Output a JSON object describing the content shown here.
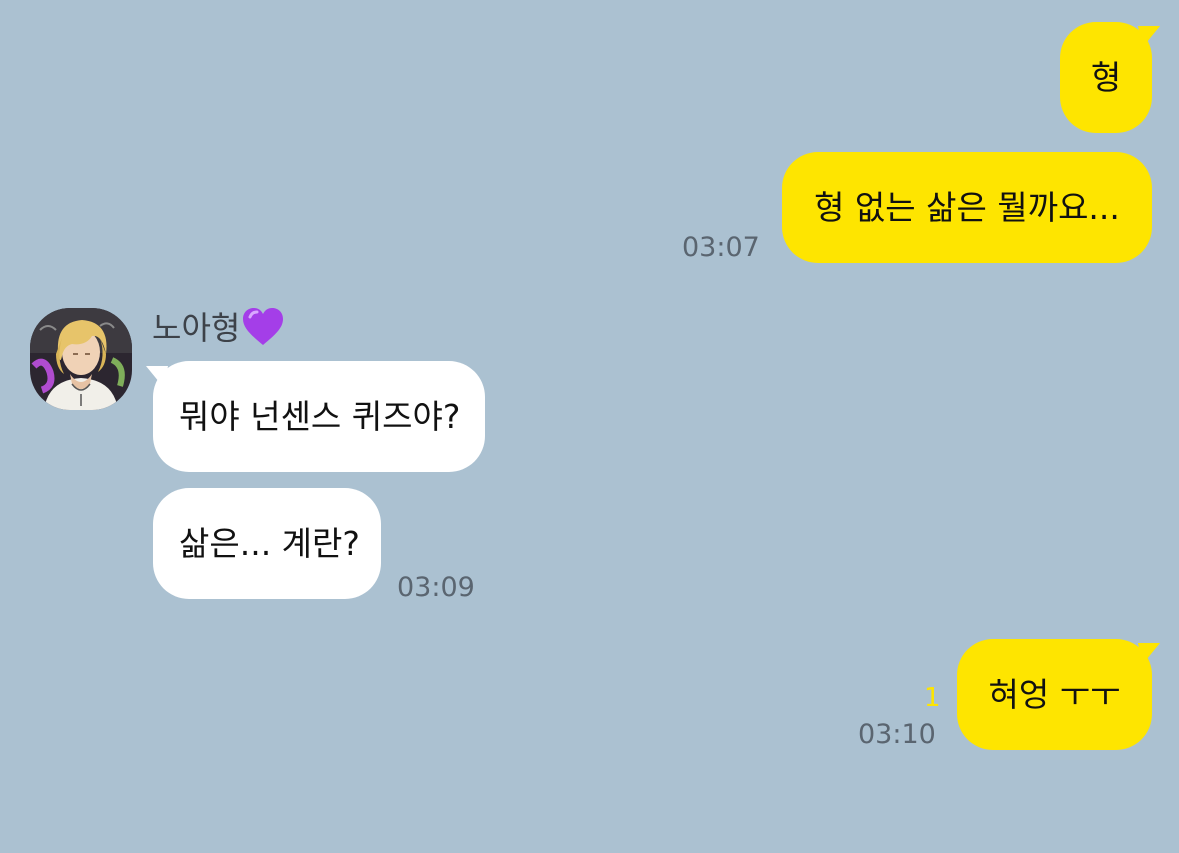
{
  "chat": {
    "messages": [
      {
        "side": "sent",
        "text": "형",
        "time": ""
      },
      {
        "side": "sent",
        "text": "형 없는 삶은 뭘까요...",
        "time": "03:07"
      },
      {
        "side": "received",
        "sender": "노아형",
        "text": "뭐야 넌센스 퀴즈야?",
        "time": ""
      },
      {
        "side": "received",
        "text": "삶은... 계란?",
        "time": "03:09"
      },
      {
        "side": "sent",
        "text": "혀엉 ㅜㅜ",
        "time": "03:10",
        "unread": "1"
      }
    ],
    "sender_badge_icon": "purple-heart-icon"
  },
  "colors": {
    "background": "#abc1d1",
    "sent_bubble": "#fee500",
    "received_bubble": "#ffffff",
    "unread_count": "#fee500"
  }
}
